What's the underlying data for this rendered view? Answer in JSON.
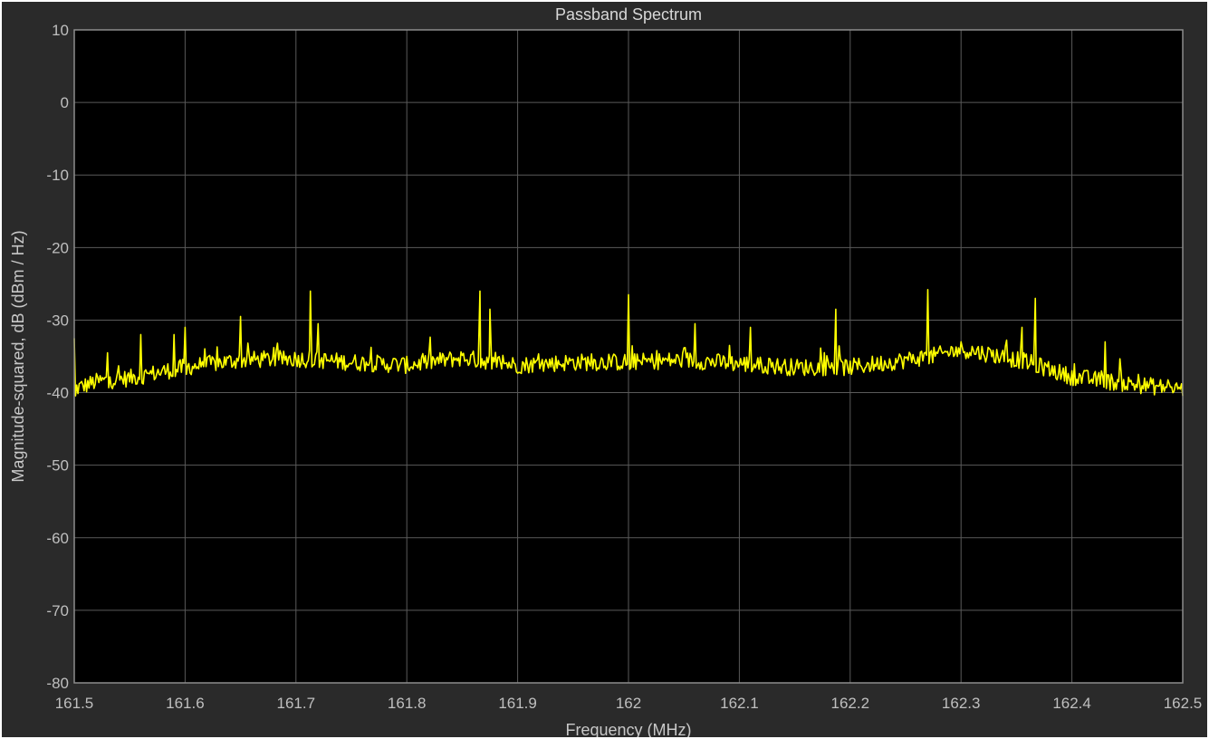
{
  "colors": {
    "figure_background": "#2a2a2a",
    "plot_background": "#000000",
    "grid": "#5a5a5a",
    "axes": "#8c8c8c",
    "trace": "#ffff00",
    "text": "#bfbfbf"
  },
  "chart_data": {
    "type": "line",
    "title": "Passband Spectrum",
    "xlabel": "Frequency (MHz)",
    "ylabel": "Magnitude-squared, dB (dBm / Hz)",
    "xlim": [
      161.5,
      162.5
    ],
    "ylim": [
      -80,
      10
    ],
    "grid": true,
    "xticks": [
      161.5,
      161.6,
      161.7,
      161.8,
      161.9,
      162.0,
      162.1,
      162.2,
      162.3,
      162.4,
      162.5
    ],
    "xtick_labels": [
      "161.5",
      "161.6",
      "161.7",
      "161.8",
      "161.9",
      "162",
      "162.1",
      "162.2",
      "162.3",
      "162.4",
      "162.5"
    ],
    "yticks": [
      10,
      0,
      -10,
      -20,
      -30,
      -40,
      -50,
      -60,
      -70,
      -80
    ],
    "ytick_labels": [
      "10",
      "0",
      "-10",
      "-20",
      "-30",
      "-40",
      "-50",
      "-60",
      "-70",
      "-80"
    ],
    "series": [
      {
        "name": "",
        "color": "#ffff00",
        "baseline": {
          "x": [
            161.5,
            161.52,
            161.55,
            161.6,
            161.65,
            161.7,
            161.75,
            161.8,
            161.85,
            161.9,
            161.95,
            162.0,
            162.05,
            162.1,
            162.15,
            162.2,
            162.25,
            162.28,
            162.3,
            162.33,
            162.36,
            162.4,
            162.45,
            162.5
          ],
          "y": [
            -39.5,
            -38.5,
            -38.0,
            -36.5,
            -35.5,
            -35.3,
            -35.8,
            -36.2,
            -35.2,
            -36.2,
            -35.8,
            -35.8,
            -35.5,
            -36.0,
            -36.5,
            -36.5,
            -35.5,
            -34.8,
            -34.0,
            -34.8,
            -35.8,
            -37.8,
            -38.8,
            -39.5
          ]
        },
        "peaks": {
          "x": [
            161.5,
            161.53,
            161.56,
            161.59,
            161.6,
            161.65,
            161.713,
            161.72,
            161.866,
            161.875,
            162.0,
            162.06,
            162.11,
            162.187,
            162.27,
            162.355,
            162.367,
            162.43
          ],
          "y": [
            -32.5,
            -34.5,
            -32.0,
            -32.0,
            -31.0,
            -29.5,
            -26.0,
            -30.5,
            -26.0,
            -28.5,
            -26.5,
            -30.5,
            -31.0,
            -28.5,
            -25.8,
            -31.0,
            -27.0,
            -33.0
          ]
        }
      }
    ]
  }
}
